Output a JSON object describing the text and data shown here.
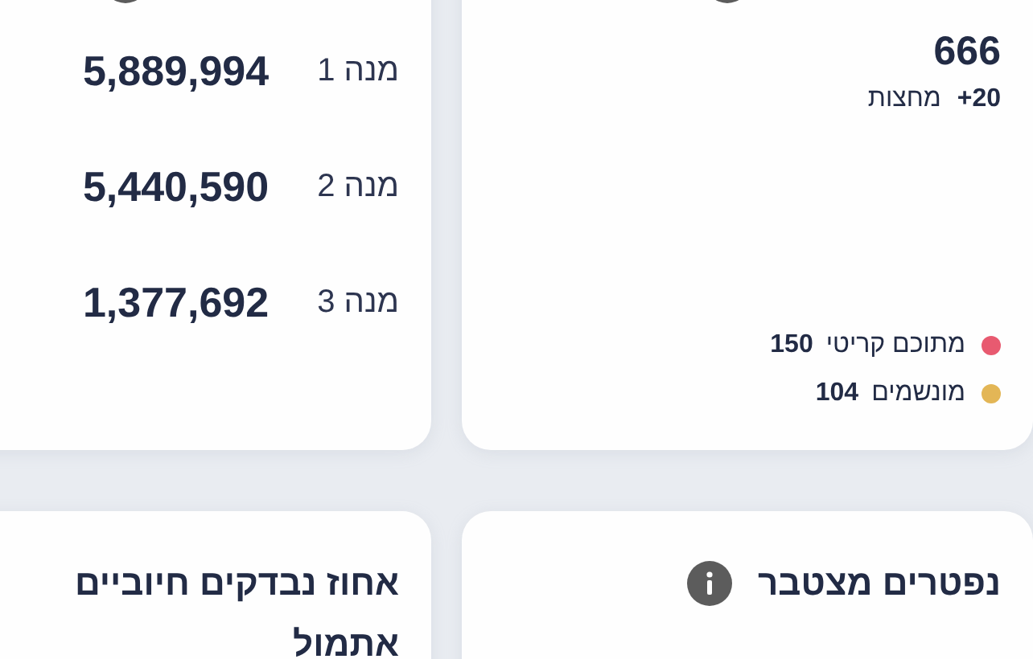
{
  "cards": [
    {
      "kind": "stat",
      "info": true,
      "value": "666",
      "delta": {
        "value": "+20",
        "label": "מחצות"
      },
      "legend": [
        {
          "label": "מתוכם קריטי",
          "value": "150",
          "color": "#e85a70"
        },
        {
          "label": "מונשמים",
          "value": "104",
          "color": "#e3b656"
        }
      ]
    },
    {
      "kind": "list",
      "info": true,
      "rows": [
        {
          "label": "מנה 1",
          "value": "5,889,994"
        },
        {
          "label": "מנה 2",
          "value": "5,440,590"
        },
        {
          "label": "מנה 3",
          "value": "1,377,692"
        }
      ]
    },
    {
      "kind": "stat",
      "title": "נפטרים מצטבר",
      "info": true
    },
    {
      "kind": "stat",
      "title": "אחוז נבדקים חיוביים אתמול",
      "info": false
    }
  ]
}
